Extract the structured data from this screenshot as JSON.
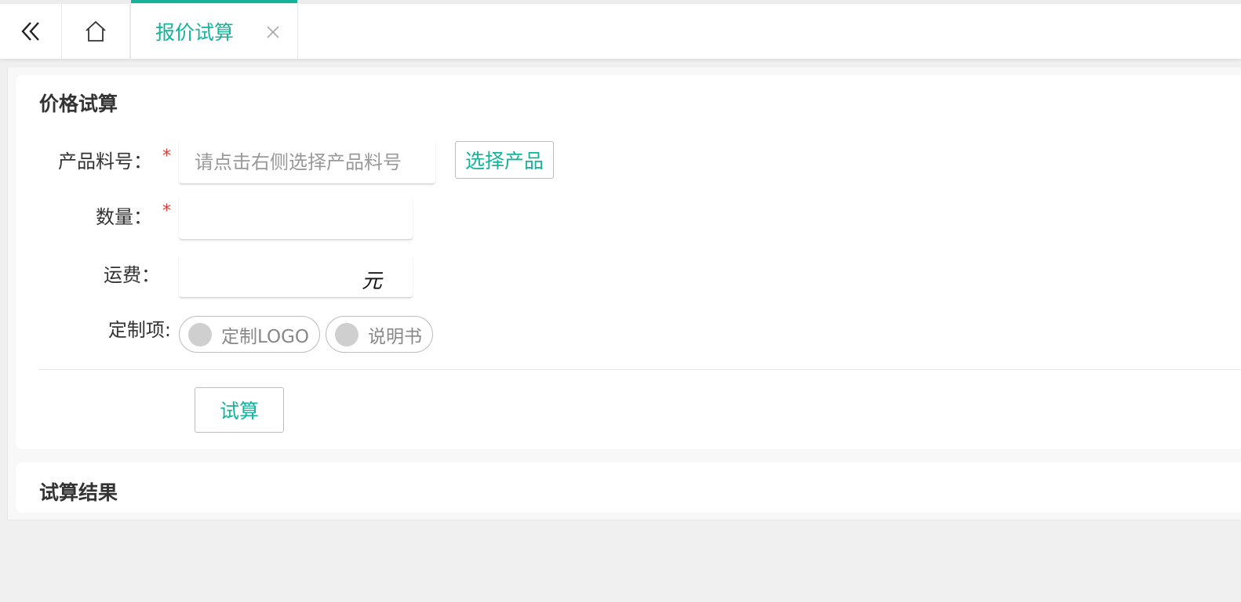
{
  "tabbar": {
    "collapse_icon": "double-chevron-left-icon",
    "home_icon": "home-icon",
    "tabs": [
      {
        "label": "报价试算",
        "active": true,
        "close_icon": "close-icon"
      }
    ],
    "accent_color": "#16b39b"
  },
  "calc_card": {
    "title": "价格试算",
    "product_no": {
      "label": "产品料号：",
      "required_mark": "*",
      "placeholder": "请点击右侧选择产品料号",
      "value": ""
    },
    "select_product_button": "选择产品",
    "quantity": {
      "label": "数量：",
      "required_mark": "*",
      "value": ""
    },
    "shipping": {
      "label": "运费：",
      "value": "",
      "unit": "元"
    },
    "customization": {
      "label": "定制项:",
      "options": [
        {
          "label": "定制LOGO",
          "checked": false
        },
        {
          "label": "说明书",
          "checked": false
        }
      ]
    },
    "calculate_button": "试算"
  },
  "result_card": {
    "title": "试算结果"
  }
}
